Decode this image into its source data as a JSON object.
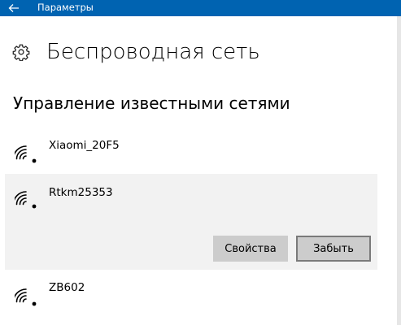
{
  "window": {
    "title": "Параметры",
    "accent_color": "#0063B1"
  },
  "header": {
    "icon": "gear-icon",
    "title": "Беспроводная сеть"
  },
  "section": {
    "title": "Управление известными сетями"
  },
  "networks": [
    {
      "name": "Xiaomi_20F5",
      "icon": "wifi-icon",
      "selected": false
    },
    {
      "name": "Rtkm25353",
      "icon": "wifi-icon",
      "selected": true
    },
    {
      "name": "ZB602",
      "icon": "wifi-icon",
      "selected": false
    }
  ],
  "actions": {
    "properties_label": "Свойства",
    "forget_label": "Забыть"
  }
}
